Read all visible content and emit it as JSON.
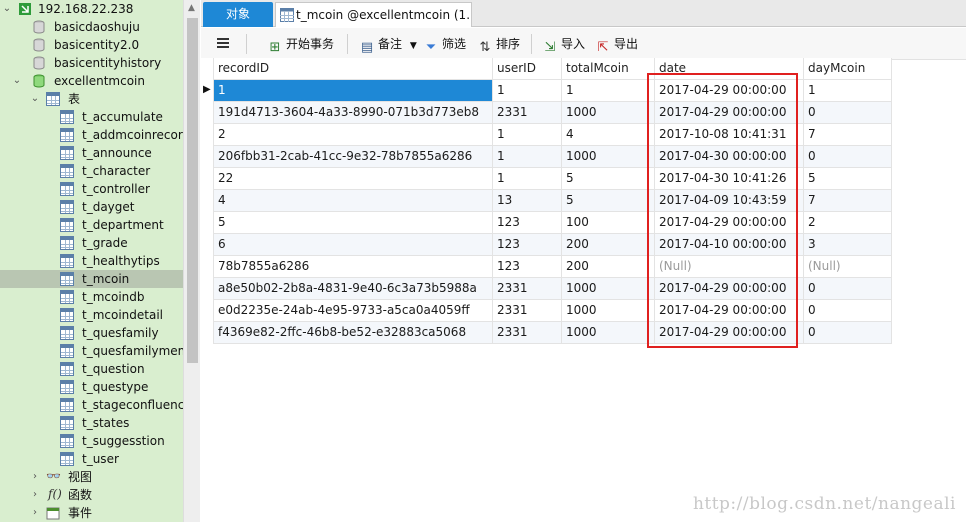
{
  "tree": {
    "server": "192.168.22.238",
    "databases": [
      "basicdaoshuju",
      "basicentity2.0",
      "basicentityhistory",
      "excellentmcoin"
    ],
    "tables_folder": "表",
    "tables": [
      "t_accumulate",
      "t_addmcoinrecord",
      "t_announce",
      "t_character",
      "t_controller",
      "t_dayget",
      "t_department",
      "t_grade",
      "t_healthytips",
      "t_mcoin",
      "t_mcoindb",
      "t_mcoindetail",
      "t_quesfamily",
      "t_quesfamilymember",
      "t_question",
      "t_questype",
      "t_stageconfluence",
      "t_states",
      "t_suggesstion",
      "t_user"
    ],
    "selected_table": "t_mcoin",
    "folders": [
      "视图",
      "函数",
      "事件"
    ]
  },
  "tabs": {
    "objects": "对象",
    "active": "t_mcoin @excellentmcoin (1..."
  },
  "toolbar": {
    "begin_transaction": "开始事务",
    "memo": "备注",
    "filter": "筛选",
    "sort": "排序",
    "import": "导入",
    "export": "导出"
  },
  "grid": {
    "columns": [
      "recordID",
      "userID",
      "totalMcoin",
      "date",
      "dayMcoin"
    ],
    "rows": [
      [
        "1",
        "1",
        "1",
        "2017-04-29 00:00:00",
        "1"
      ],
      [
        "191d4713-3604-4a33-8990-071b3d773eb8",
        "2331",
        "1000",
        "2017-04-29 00:00:00",
        "0"
      ],
      [
        "2",
        "1",
        "4",
        "2017-10-08 10:41:31",
        "7"
      ],
      [
        "206fbb31-2cab-41cc-9e32-78b7855a6286",
        "1",
        "1000",
        "2017-04-30 00:00:00",
        "0"
      ],
      [
        "22",
        "1",
        "5",
        "2017-04-30 10:41:26",
        "5"
      ],
      [
        "4",
        "13",
        "5",
        "2017-04-09 10:43:59",
        "7"
      ],
      [
        "5",
        "123",
        "100",
        "2017-04-29 00:00:00",
        "2"
      ],
      [
        "6",
        "123",
        "200",
        "2017-04-10 00:00:00",
        "3"
      ],
      [
        "78b7855a6286",
        "123",
        "200",
        "(Null)",
        "(Null)"
      ],
      [
        "a8e50b02-2b8a-4831-9e40-6c3a73b5988a",
        "2331",
        "1000",
        "2017-04-29 00:00:00",
        "0"
      ],
      [
        "e0d2235e-24ab-4e95-9733-a5ca0a4059ff",
        "2331",
        "1000",
        "2017-04-29 00:00:00",
        "0"
      ],
      [
        "f4369e82-2ffc-46b8-be52-e32883ca5068",
        "2331",
        "1000",
        "2017-04-29 00:00:00",
        "0"
      ]
    ]
  },
  "watermark": "http://blog.csdn.net/nangeali",
  "colors": {
    "tree_bg": "#d9eecf",
    "selection_blue": "#1e88d6",
    "highlight_red": "#e0201f"
  }
}
